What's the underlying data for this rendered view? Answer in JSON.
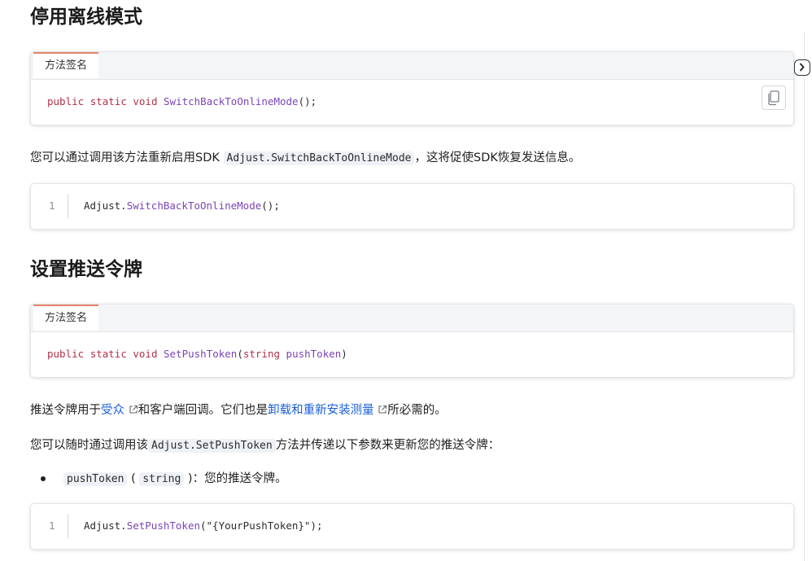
{
  "sections": [
    {
      "heading": "停用离线模式",
      "signature": {
        "tab_label": "方法签名",
        "kw1": "public",
        "kw2": "static",
        "kw3": "void",
        "method": "SwitchBackToOnlineMode",
        "args": "();"
      },
      "description": {
        "before": "您可以通过调用该方法重新启用SDK",
        "code": "Adjust.SwitchBackToOnlineMode",
        "after": "，这将促使SDK恢复发送信息。"
      },
      "example": {
        "line_number": "1",
        "object": "Adjust.",
        "method": "SwitchBackToOnlineMode",
        "args": "();"
      }
    },
    {
      "heading": "设置推送令牌",
      "signature": {
        "tab_label": "方法签名",
        "kw1": "public",
        "kw2": "static",
        "kw3": "void",
        "method": "SetPushToken",
        "paren_open": "(",
        "param_type": "string",
        "param_name": "pushToken",
        "paren_close": ")"
      },
      "para1": {
        "before": "推送令牌用于",
        "link1": "受众",
        "middle": "和客户端回调。它们也是",
        "link2": "卸载和重新安装测量",
        "after": "所必需的。"
      },
      "para2": {
        "before": "您可以随时通过调用该",
        "code": "Adjust.SetPushToken",
        "after": "方法并传递以下参数来更新您的推送令牌："
      },
      "params": [
        {
          "name": "pushToken",
          "open": "(",
          "type": "string",
          "close": ")",
          "desc": "：您的推送令牌。"
        }
      ],
      "example": {
        "line_number": "1",
        "object": "Adjust.",
        "method": "SetPushToken",
        "args": "(\"{YourPushToken}\");"
      }
    }
  ],
  "icons": {
    "copy": "copy-icon",
    "external_link": "external-link-icon",
    "toggle": "chevron-right-icon"
  },
  "colors": {
    "keyword": "#b2324a",
    "method": "#7a45b5",
    "link": "#1a5fd6",
    "tab_accent": "#e5836a"
  }
}
